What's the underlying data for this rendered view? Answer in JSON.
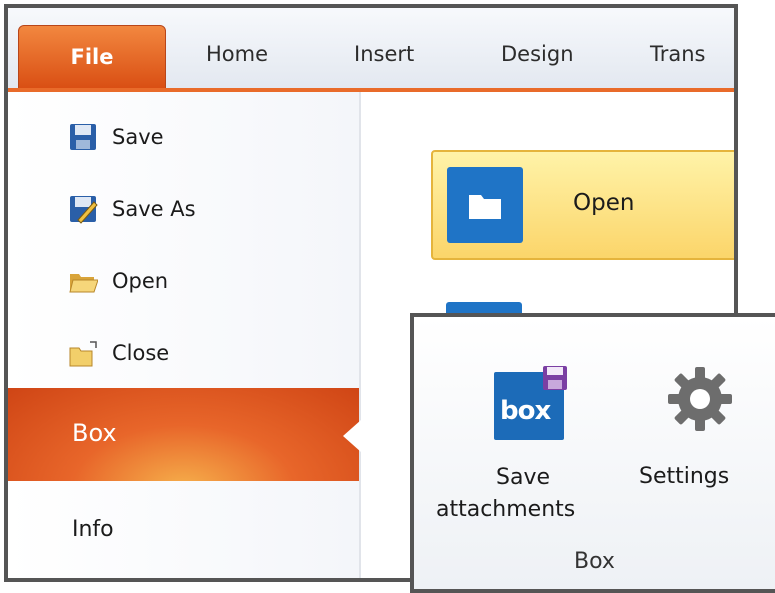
{
  "ribbon": {
    "tabs": [
      "File",
      "Home",
      "Insert",
      "Design",
      "Trans"
    ],
    "accent_color": "#e96b2a"
  },
  "sidebar": {
    "items": [
      {
        "label": "Save",
        "icon": "save-disk-icon"
      },
      {
        "label": "Save As",
        "icon": "save-as-icon"
      },
      {
        "label": "Open",
        "icon": "open-folder-icon"
      },
      {
        "label": "Close",
        "icon": "close-folder-icon"
      }
    ],
    "selected": "Box",
    "info": "Info"
  },
  "content": {
    "open_button": "Open"
  },
  "box_group": {
    "save_line1": "Save",
    "save_line2": "attachments",
    "box_logo_text": "box",
    "settings": "Settings",
    "group_label": "Box"
  }
}
